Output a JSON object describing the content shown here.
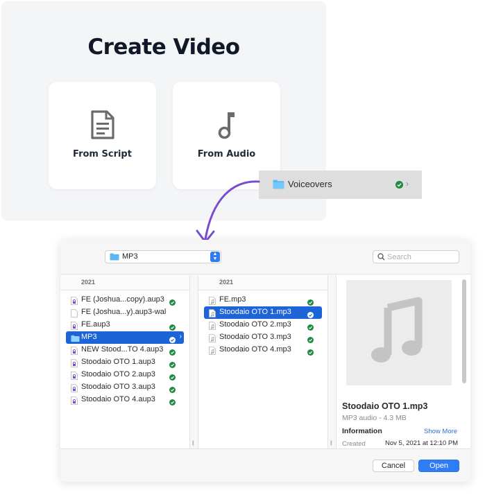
{
  "create_video": {
    "title": "Create Video",
    "options": [
      {
        "label": "From Script",
        "icon": "document-icon"
      },
      {
        "label": "From Audio",
        "icon": "music-note-icon"
      }
    ]
  },
  "voiceovers_item": {
    "label": "Voiceovers",
    "status": "synced"
  },
  "dialog": {
    "location": "MP3",
    "search_placeholder": "Search",
    "column1": {
      "header": "2021",
      "items": [
        {
          "name": "FE (Joshua...copy).aup3",
          "type": "aup3",
          "synced": true,
          "selected": false
        },
        {
          "name": "FE (Joshua...y).aup3-wal",
          "type": "doc",
          "synced": false,
          "selected": false
        },
        {
          "name": "FE.aup3",
          "type": "aup3",
          "synced": true,
          "selected": false
        },
        {
          "name": "MP3",
          "type": "folder",
          "synced": true,
          "selected": true
        },
        {
          "name": "NEW Stood...TO 4.aup3",
          "type": "aup3",
          "synced": true,
          "selected": false
        },
        {
          "name": "Stoodaio OTO 1.aup3",
          "type": "aup3",
          "synced": true,
          "selected": false
        },
        {
          "name": "Stoodaio OTO 2.aup3",
          "type": "aup3",
          "synced": true,
          "selected": false
        },
        {
          "name": "Stoodaio OTO 3.aup3",
          "type": "aup3",
          "synced": true,
          "selected": false
        },
        {
          "name": "Stoodaio OTO 4.aup3",
          "type": "aup3",
          "synced": true,
          "selected": false
        }
      ]
    },
    "column2": {
      "header": "2021",
      "items": [
        {
          "name": "FE.mp3",
          "type": "mp3",
          "synced": true,
          "selected": false
        },
        {
          "name": "Stoodaio OTO 1.mp3",
          "type": "mp3",
          "synced": true,
          "selected": true
        },
        {
          "name": "Stoodaio OTO 2.mp3",
          "type": "mp3",
          "synced": true,
          "selected": false
        },
        {
          "name": "Stoodaio OTO 3.mp3",
          "type": "mp3",
          "synced": true,
          "selected": false
        },
        {
          "name": "Stoodaio OTO 4.mp3",
          "type": "mp3",
          "synced": true,
          "selected": false
        }
      ]
    },
    "preview": {
      "name": "Stoodaio OTO 1.mp3",
      "kind": "MP3 audio - 4.3 MB",
      "info_heading": "Information",
      "show_more": "Show More",
      "created_label": "Created",
      "created_value": "Nov 5, 2021 at 12:10 PM"
    },
    "buttons": {
      "cancel": "Cancel",
      "open": "Open"
    }
  },
  "colors": {
    "accent": "#2f7cf6",
    "selection": "#1d64d8",
    "synced_green": "#1f8a43",
    "arrow_purple": "#7b4bcf"
  }
}
